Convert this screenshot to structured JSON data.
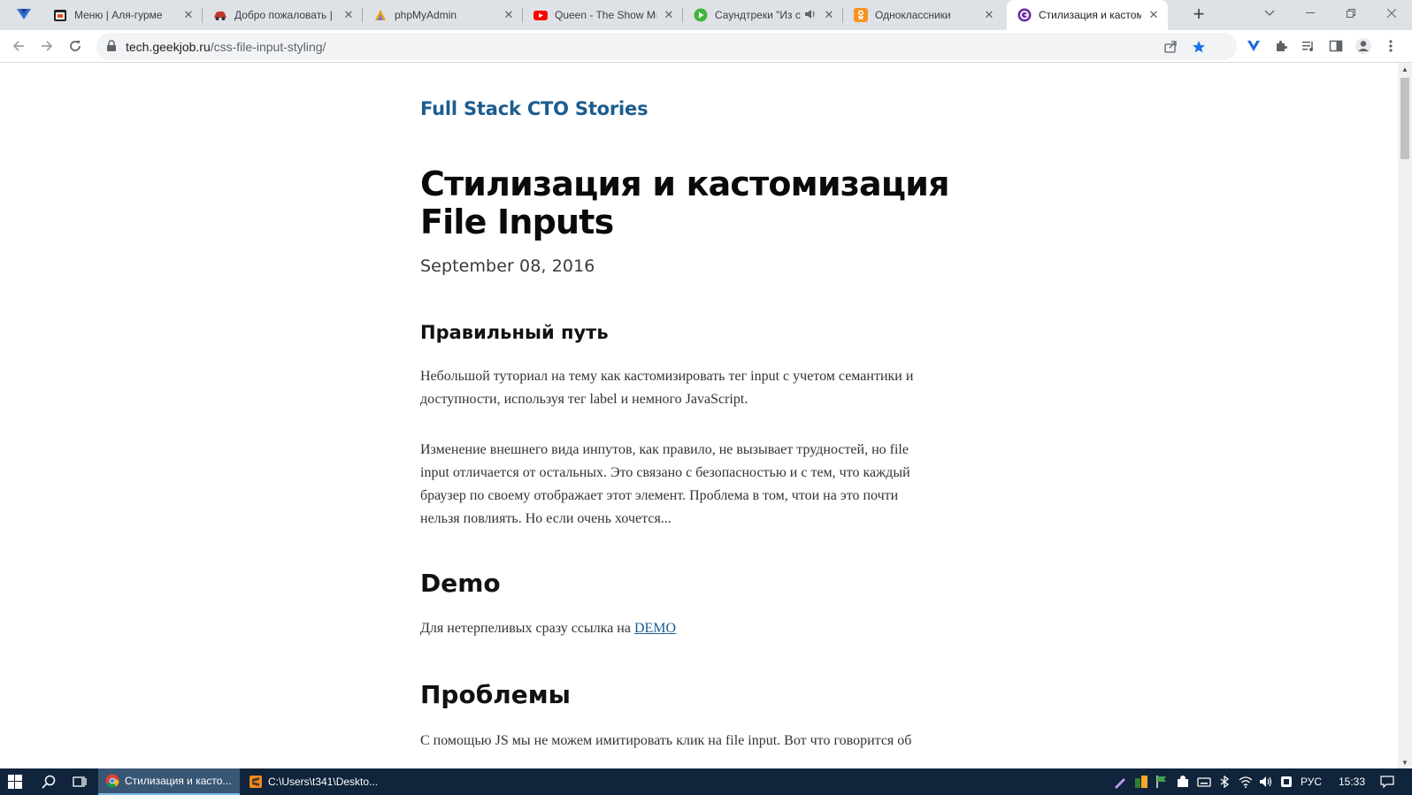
{
  "browser": {
    "tabs": [
      {
        "title": "Меню | Аля-гурме",
        "icon": "calendar-icon"
      },
      {
        "title": "Добро пожаловать | E",
        "icon": "car-icon"
      },
      {
        "title": "phpMyAdmin",
        "icon": "phpmyadmin-icon"
      },
      {
        "title": "Queen - The Show Mu",
        "icon": "youtube-icon"
      },
      {
        "title": "Саундтреки \"Из с",
        "icon": "play-icon",
        "audio": "speaker-icon"
      },
      {
        "title": "Одноклассники",
        "icon": "odnoklassniki-icon"
      },
      {
        "title": "Стилизация и кастом",
        "icon": "geekjob-icon",
        "active": true
      }
    ],
    "new_tab": "+",
    "address": {
      "host": "tech.geekjob.ru",
      "path": "/css-file-input-styling/"
    }
  },
  "article": {
    "site_title": "Full Stack CTO Stories",
    "title_line1": "Стилизация и кастомизация",
    "title_line2": "File Inputs",
    "date": "September 08, 2016",
    "section1_heading": "Правильный путь",
    "para1_line1": "Небольшой туториал на тему как кастомизировать тег input с учетом семантики и",
    "para1_line2": "доступности, используя тег label и немного JavaScript.",
    "para2_line1": "Изменение внешнего вида инпутов, как правило, не вызывает трудностей, но file",
    "para2_line2": "input отличается от остальных. Это связано с безопасностью и с тем, что каждый",
    "para2_line3": "браузер по своему отображает этот элемент. Проблема в том, чтои на это почти",
    "para2_line4": "нельзя повлиять. Но если очень хочется...",
    "section2_heading": "Demo",
    "demo_text": "Для нетерпеливых сразу ссылка на ",
    "demo_link": "DEMO",
    "section3_heading": "Проблемы",
    "para3_line1": "С помощью JS мы не можем имитировать клик на file input. Вот что говорится об"
  },
  "taskbar": {
    "apps": [
      {
        "label": "Стилизация и касто...",
        "icon": "chrome-icon",
        "active": true
      },
      {
        "label": "C:\\Users\\t341\\Deskto...",
        "icon": "sublime-icon",
        "active": false
      }
    ],
    "language": "РУС",
    "time": "15:33"
  },
  "colors": {
    "site_title": "#1c5d8f",
    "taskbar": "#10243b",
    "tabstrip": "#dee1e6"
  }
}
